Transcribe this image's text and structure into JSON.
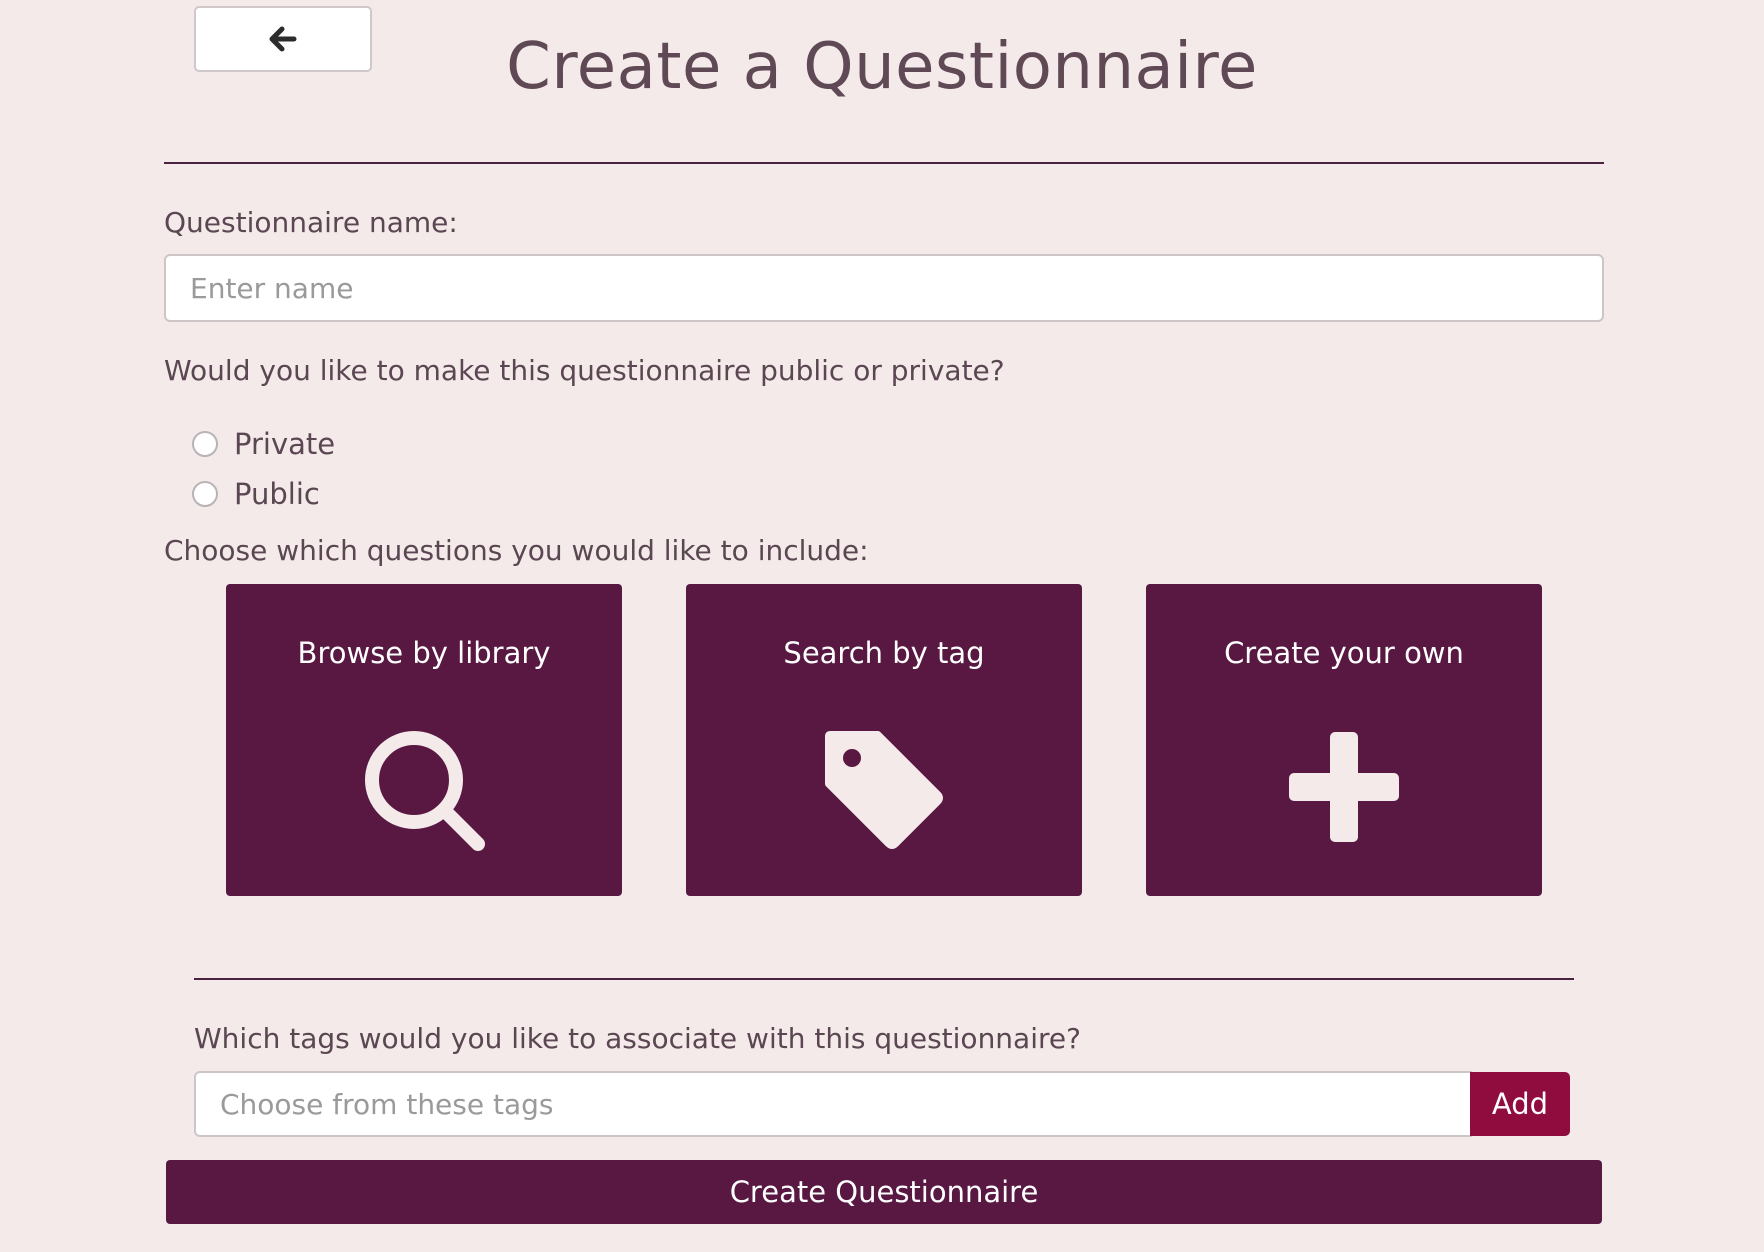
{
  "back_button": {
    "icon": "arrow-left-icon"
  },
  "title": "Create a Questionnaire",
  "name_field": {
    "label": "Questionnaire name:",
    "placeholder": "Enter name",
    "value": ""
  },
  "visibility": {
    "question": "Would you like to make this questionnaire public or private?",
    "options": [
      "Private",
      "Public"
    ],
    "selected": null
  },
  "questions": {
    "prompt": "Choose which questions you would like to include:",
    "cards": [
      {
        "label": "Browse by library",
        "icon": "search-icon"
      },
      {
        "label": "Search by tag",
        "icon": "tag-icon"
      },
      {
        "label": "Create your own",
        "icon": "plus-icon"
      }
    ]
  },
  "tags": {
    "question": "Which tags would you like to associate with this questionnaire?",
    "placeholder": "Choose from these tags",
    "value": "",
    "add_label": "Add"
  },
  "submit_label": "Create Questionnaire",
  "colors": {
    "background": "#f5eaea",
    "primary": "#581842",
    "accent": "#900c3f",
    "text": "#5a4752"
  }
}
